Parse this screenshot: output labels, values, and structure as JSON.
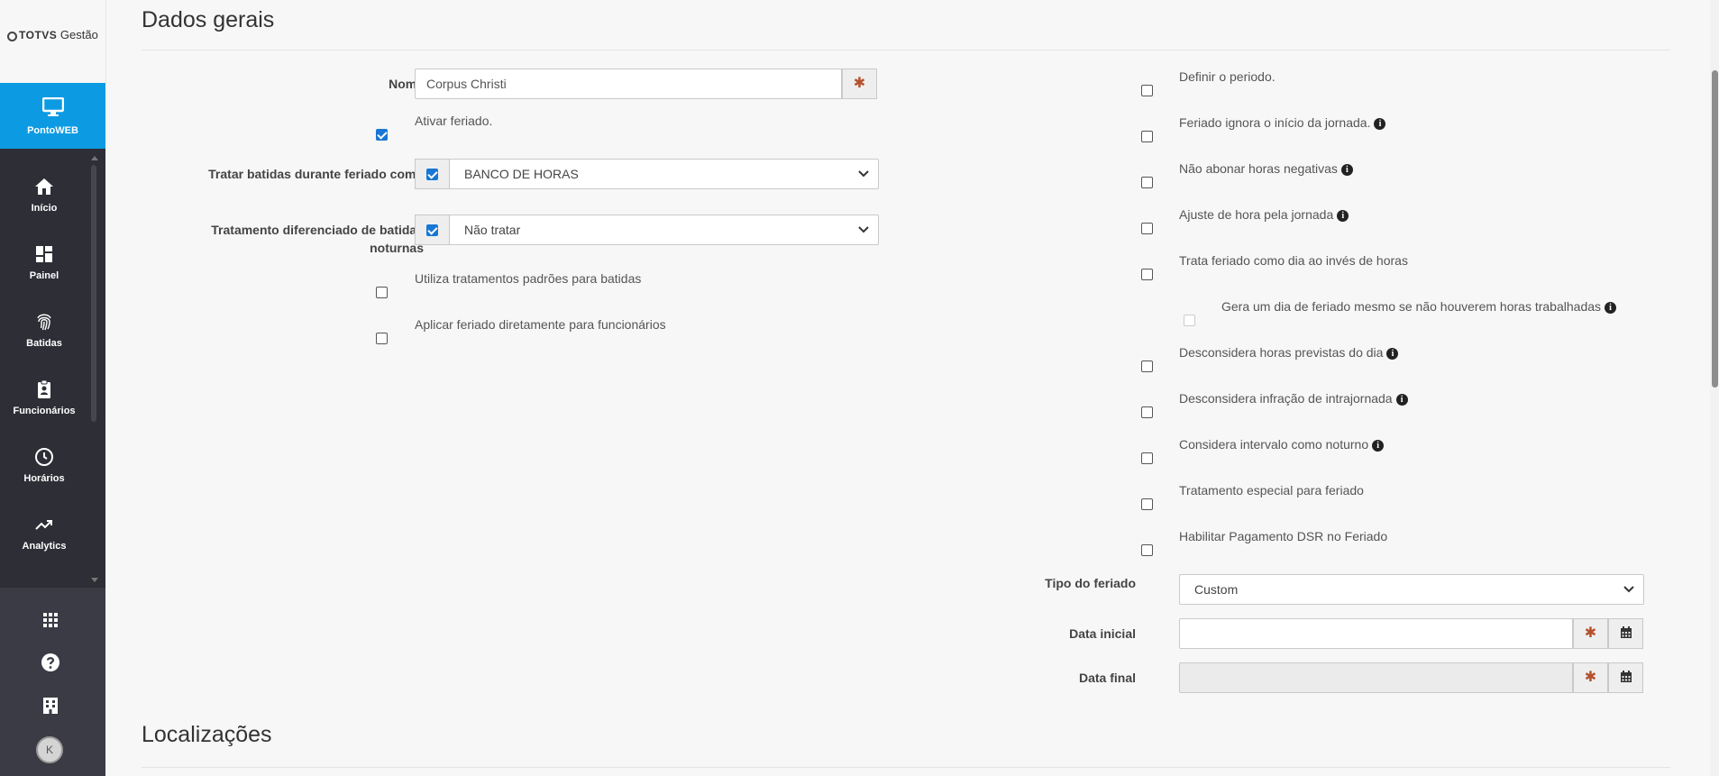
{
  "brand": {
    "name_bold": "TOTVS",
    "name_rest": "Gestão"
  },
  "app": {
    "label": "PontoWEB",
    "icon": "monitor-icon"
  },
  "nav": [
    {
      "label": "Início",
      "icon": "home-icon"
    },
    {
      "label": "Painel",
      "icon": "dashboard-icon"
    },
    {
      "label": "Batidas",
      "icon": "fingerprint-icon"
    },
    {
      "label": "Funcionários",
      "icon": "clipboard-user-icon"
    },
    {
      "label": "Horários",
      "icon": "clock-icon"
    },
    {
      "label": "Analytics",
      "icon": "trend-icon"
    }
  ],
  "user": {
    "initial": "K"
  },
  "section": {
    "title": "Dados gerais",
    "second_title": "Localizações"
  },
  "form": {
    "nome_label": "Nome",
    "nome_value": "Corpus Christi",
    "ativar_label": "Ativar feriado.",
    "ativar_checked": true,
    "tratar_label": "Tratar batidas durante feriado como",
    "tratar_checked": true,
    "tratar_value": "BANCO DE HORAS",
    "noturno_label": "Tratamento diferenciado de batidas noturnas",
    "noturno_checked": true,
    "noturno_value": "Não tratar",
    "padroes_label": "Utiliza tratamentos padrões para batidas",
    "aplicar_label": "Aplicar feriado diretamente para funcionários"
  },
  "right_options": [
    {
      "label": "Definir o periodo.",
      "info": false
    },
    {
      "label": "Feriado ignora o início da jornada.",
      "info": true
    },
    {
      "label": "Não abonar horas negativas",
      "info": true
    },
    {
      "label": "Ajuste de hora pela jornada",
      "info": true
    },
    {
      "label": "Trata feriado como dia ao invés de horas",
      "info": false
    },
    {
      "label": "Gera um dia de feriado mesmo se não houverem horas trabalhadas",
      "info": true,
      "disabled": true
    },
    {
      "label": "Desconsidera horas previstas do dia",
      "info": true
    },
    {
      "label": "Desconsidera infração de intrajornada",
      "info": true
    },
    {
      "label": "Considera intervalo como noturno",
      "info": true
    },
    {
      "label": "Tratamento especial para feriado",
      "info": false
    },
    {
      "label": "Habilitar Pagamento DSR no Feriado",
      "info": false
    }
  ],
  "tipo": {
    "label": "Tipo do feriado",
    "value": "Custom"
  },
  "data_inicial": {
    "label": "Data inicial",
    "value": ""
  },
  "data_final": {
    "label": "Data final",
    "value": ""
  },
  "colors": {
    "sidebar": "#2d2e36",
    "accent": "#0c9be2",
    "checkbox": "#1877d4",
    "required": "#b5502c"
  }
}
